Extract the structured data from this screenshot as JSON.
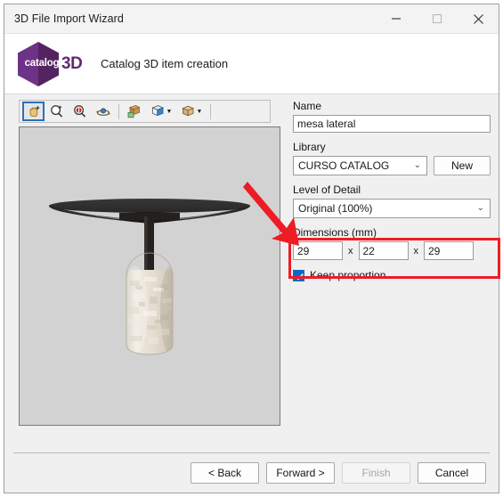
{
  "window": {
    "title": "3D File Import Wizard",
    "controls": [
      {
        "name": "minimize",
        "glyph": "minimize-icon"
      },
      {
        "name": "maximize",
        "glyph": "maximize-icon"
      },
      {
        "name": "close",
        "glyph": "close-icon"
      }
    ]
  },
  "header": {
    "logo_word": "catalog",
    "logo_suffix": "3D",
    "title": "Catalog 3D item creation",
    "brand_color": "#5f2a72"
  },
  "toolbar": {
    "items": [
      {
        "name": "pan-tool",
        "icon": "hand-pan-icon",
        "selected": true,
        "caret": false
      },
      {
        "name": "zoom-in-tool",
        "icon": "magnifier-plus-icon",
        "selected": false,
        "caret": false
      },
      {
        "name": "zoom-area-tool",
        "icon": "magnifier-icon",
        "selected": false,
        "caret": false
      },
      {
        "name": "orbit-tool",
        "icon": "orbit-rotate-icon",
        "selected": false,
        "caret": false
      },
      {
        "name": "fit-view-tool",
        "icon": "box-add-icon",
        "selected": false,
        "caret": false
      },
      {
        "name": "render-mode-tool",
        "icon": "box-shaded-icon",
        "selected": false,
        "caret": true
      },
      {
        "name": "view-preset-tool",
        "icon": "box-wire-icon",
        "selected": false,
        "caret": true
      }
    ]
  },
  "preview": {
    "name": "3d-model-preview",
    "background": "#d2d2d2",
    "model": "side table with dark elliptical top and stone textured cylindrical base"
  },
  "form": {
    "name": {
      "label": "Name",
      "value": "mesa lateral"
    },
    "library": {
      "label": "Library",
      "value": "CURSO CATALOG",
      "new_button": "New"
    },
    "level_of_detail": {
      "label": "Level of Detail",
      "value": "Original (100%)"
    },
    "dimensions": {
      "label": "Dimensions (mm)",
      "separator": "x",
      "width": "29",
      "height": "22",
      "depth": "29"
    },
    "keep_proportion": {
      "label": "Keep proportion",
      "checked": true
    }
  },
  "annotation": {
    "highlight_color": "#ee1c25",
    "arrow_target": "library-field"
  },
  "footer": {
    "back": "< Back",
    "forward": "Forward >",
    "finish": "Finish",
    "cancel": "Cancel",
    "finish_disabled": true
  }
}
